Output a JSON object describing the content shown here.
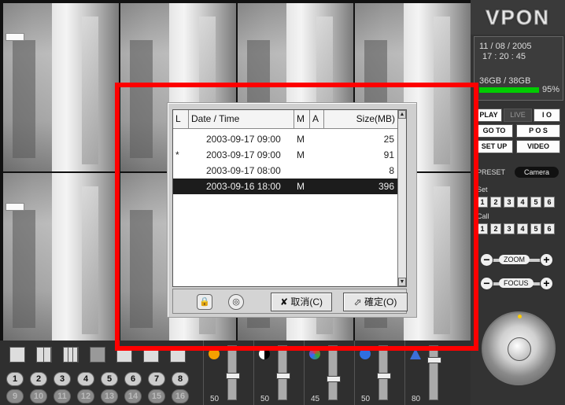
{
  "logo": "VPON",
  "datetime": {
    "date": "11 / 08 / 2005",
    "time": "17 : 20 : 45"
  },
  "disk": {
    "usage": "36GB / 38GB",
    "percent": "95%"
  },
  "mode_buttons": [
    "PLAY",
    "LIVE",
    "I O",
    "GO TO",
    "P O S",
    "SET UP",
    "VIDEO"
  ],
  "ptz": {
    "preset_label": "PRESET",
    "camera_label": "Camera",
    "set_label": "Set",
    "call_label": "Call",
    "numbers": [
      "1",
      "2",
      "3",
      "4",
      "5",
      "6"
    ],
    "zoom_label": "ZOOM",
    "focus_label": "FOCUS"
  },
  "camera_sign": "",
  "dialog": {
    "columns": [
      "L",
      "Date / Time",
      "M",
      "A",
      "Size(MB)"
    ],
    "rows": [
      {
        "l": "",
        "datetime": "2003-09-17 09:00",
        "m": "M",
        "a": "",
        "size": "25"
      },
      {
        "l": "*",
        "datetime": "2003-09-17 09:00",
        "m": "M",
        "a": "",
        "size": "91"
      },
      {
        "l": "",
        "datetime": "2003-09-17 08:00",
        "m": "",
        "a": "",
        "size": "8"
      },
      {
        "l": "",
        "datetime": "2003-09-16 18:00",
        "m": "M",
        "a": "",
        "size": "396",
        "selected": true
      }
    ],
    "cancel_label": "✘ 取消(C)",
    "ok_label": "⬀ 確定(O)"
  },
  "channels": [
    "1",
    "2",
    "3",
    "4",
    "5",
    "6",
    "7",
    "8",
    "9",
    "10",
    "11",
    "12",
    "13",
    "14",
    "15",
    "16"
  ],
  "sliders": [
    {
      "name": "brightness",
      "value": "50",
      "color": "#f5a000"
    },
    {
      "name": "contrast",
      "value": "50",
      "color": "#ffffff"
    },
    {
      "name": "color",
      "value": "45",
      "color": "#33aa33"
    },
    {
      "name": "saturation",
      "value": "50",
      "color": "#2f6fe0"
    },
    {
      "name": "sharpness",
      "value": "80",
      "color": "#3b6fd8"
    }
  ]
}
